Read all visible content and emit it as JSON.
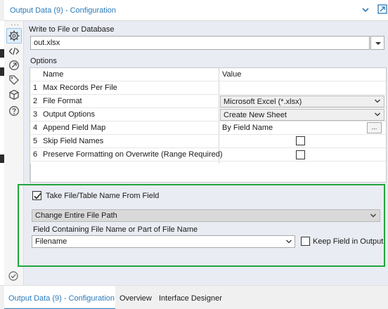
{
  "window": {
    "title": "Output Data (9) - Configuration",
    "accent_color": "#2a7ab8",
    "highlight_color": "#21a53e"
  },
  "sidebar": {
    "overflow": "···",
    "icons": [
      "gear-icon",
      "code-icon",
      "arrow-circle-icon",
      "tag-icon",
      "cube-icon",
      "help-icon"
    ]
  },
  "write_to": {
    "label": "Write to File or Database",
    "value": "out.xlsx"
  },
  "options": {
    "label": "Options",
    "headers": {
      "name": "Name",
      "value": "Value"
    },
    "rows": [
      {
        "num": "1",
        "name": "Max Records Per File",
        "value": ""
      },
      {
        "num": "2",
        "name": "File Format",
        "value": "Microsoft Excel (*.xlsx)"
      },
      {
        "num": "3",
        "name": "Output Options",
        "value": "Create New Sheet"
      },
      {
        "num": "4",
        "name": "Append Field Map",
        "value": "By Field Name",
        "button": "..."
      },
      {
        "num": "5",
        "name": "Skip Field Names",
        "checked": false
      },
      {
        "num": "6",
        "name": "Preserve Formatting on Overwrite (Range Required)",
        "checked": false
      }
    ]
  },
  "filename_from_field": {
    "checkbox_label": "Take File/Table Name From Field",
    "checked": true,
    "mode": "Change Entire File Path",
    "field_label": "Field Containing File Name or Part of File Name",
    "field_value": "Filename",
    "keep_label": "Keep Field in Output",
    "keep_checked": false
  },
  "tabs": [
    {
      "label": "Output Data (9) - Configuration",
      "active": true
    },
    {
      "label": "Overview",
      "active": false
    },
    {
      "label": "Interface Designer",
      "active": false
    }
  ]
}
